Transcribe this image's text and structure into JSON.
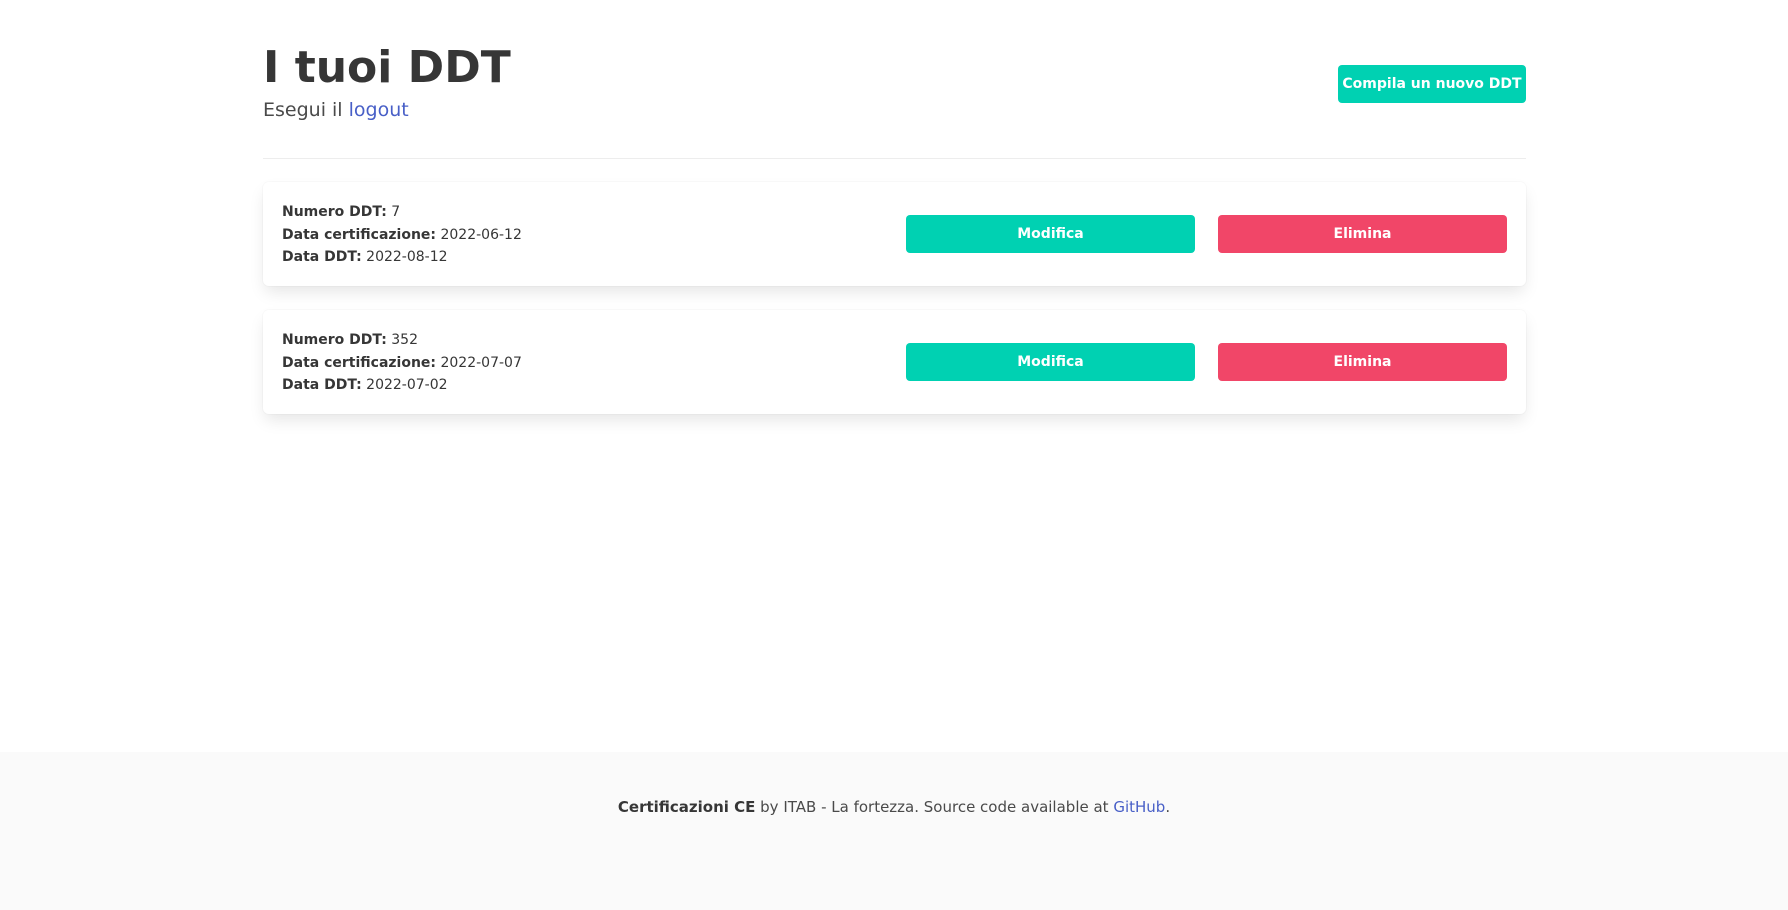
{
  "header": {
    "title": "I tuoi DDT",
    "subtitle_prefix": "Esegui il ",
    "logout_link": "logout",
    "new_button": "Compila un nuovo DDT"
  },
  "labels": {
    "numero": "Numero DDT:",
    "data_cert": "Data certificazione:",
    "data_ddt": "Data DDT:"
  },
  "ddts": [
    {
      "numero": "7",
      "data_certificazione": "2022-06-12",
      "data_ddt": "2022-08-12",
      "edit_label": "Modifica",
      "delete_label": "Elimina"
    },
    {
      "numero": "352",
      "data_certificazione": "2022-07-07",
      "data_ddt": "2022-07-02",
      "edit_label": "Modifica",
      "delete_label": "Elimina"
    }
  ],
  "footer": {
    "brand": "Certificazioni CE",
    "middle": " by ITAB - La fortezza. Source code available at ",
    "link": "GitHub",
    "end": "."
  },
  "colors": {
    "primary": "#00d1b2",
    "danger": "#f14668",
    "link": "#485fc7"
  }
}
